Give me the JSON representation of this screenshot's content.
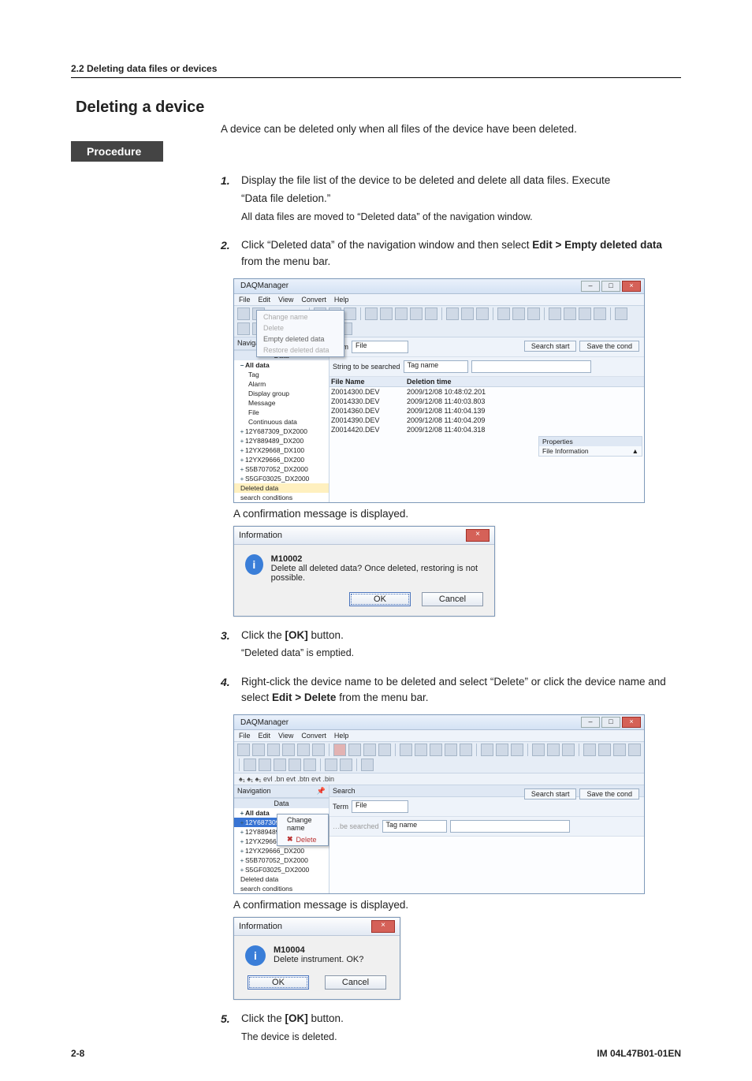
{
  "section_label": "2.2  Deleting data files or devices",
  "title": "Deleting a device",
  "intro": "A device can be deleted only when all files of the device have been deleted.",
  "procedure": "Procedure",
  "steps": {
    "s1": {
      "num": "1.",
      "line1a": "Display the file list of the device to be deleted and delete all data files. Execute",
      "line1b": "“Data file deletion.”",
      "line2": "All data files are moved to “Deleted data” of the navigation window."
    },
    "s2": {
      "num": "2.",
      "line1a": "Click “Deleted data” of the navigation window and then select ",
      "bold1": "Edit > Empty deleted data",
      "line1b": " from the menu bar."
    },
    "s3": {
      "num": "3.",
      "line1": "Click the ",
      "bold": "[OK]",
      "tail": " button.",
      "line2": "“Deleted data” is emptied."
    },
    "s4": {
      "num": "4.",
      "line1a": "Right-click the device name to be deleted and select “Delete” or click the device name and select ",
      "bold": "Edit > Delete",
      "tail": " from the menu bar."
    },
    "s5": {
      "num": "5.",
      "line1": "Click the ",
      "bold": "[OK]",
      "tail": " button.",
      "line2": "The device is deleted."
    }
  },
  "caption_confirm": "A confirmation message is displayed.",
  "app": {
    "title": "DAQManager",
    "menu": [
      "File",
      "Edit",
      "View",
      "Convert",
      "Help"
    ],
    "edit_menu": {
      "change_name": "Change name",
      "delete": "Delete",
      "empty": "Empty deleted data",
      "restore": "Restore deleted data"
    },
    "nav": {
      "head": "Navigation",
      "tab": "Data",
      "all": "All data",
      "tag": "Tag",
      "alarm": "Alarm",
      "display": "Display group",
      "message": "Message",
      "file": "File",
      "cont": "Continuous data",
      "devs": [
        "12Y687309_DX2000",
        "12Y889489_DX200",
        "12YX29668_DX100",
        "12YX29666_DX200",
        "S5B707052_DX2000",
        "S5GF03025_DX2000"
      ],
      "deleted": "Deleted data",
      "search_cond": "search conditions"
    },
    "search": {
      "head": "Search",
      "term": "Term",
      "file_label": "File",
      "string_label": "String to be searched",
      "tag_label": "Tag name",
      "btn_start": "Search start",
      "btn_save": "Save the cond"
    },
    "filelist": {
      "col_name": "File Name",
      "col_time": "Deletion time",
      "rows": [
        {
          "name": "Z0014300.DEV",
          "time": "2009/12/08 10:48:02.201"
        },
        {
          "name": "Z0014330.DEV",
          "time": "2009/12/08 11:40:03.803"
        },
        {
          "name": "Z0014360.DEV",
          "time": "2009/12/08 11:40:04.139"
        },
        {
          "name": "Z0014390.DEV",
          "time": "2009/12/08 11:40:04.209"
        },
        {
          "name": "Z0014420.DEV",
          "time": "2009/12/08 11:40:04.318"
        }
      ]
    },
    "props": {
      "head": "Properties",
      "file_info": "File Information"
    },
    "toolbar_txt": "btn evt .bin"
  },
  "app2_ctx": {
    "change": "Change name",
    "delete": "Delete"
  },
  "dlg1": {
    "title": "Information",
    "code": "M10002",
    "msg": "Delete all deleted data? Once deleted, restoring is not possible.",
    "ok": "OK",
    "cancel": "Cancel"
  },
  "dlg2": {
    "title": "Information",
    "code": "M10004",
    "msg": "Delete instrument. OK?",
    "ok": "OK",
    "cancel": "Cancel"
  },
  "footer": {
    "left": "2-8",
    "right": "IM 04L47B01-01EN"
  }
}
